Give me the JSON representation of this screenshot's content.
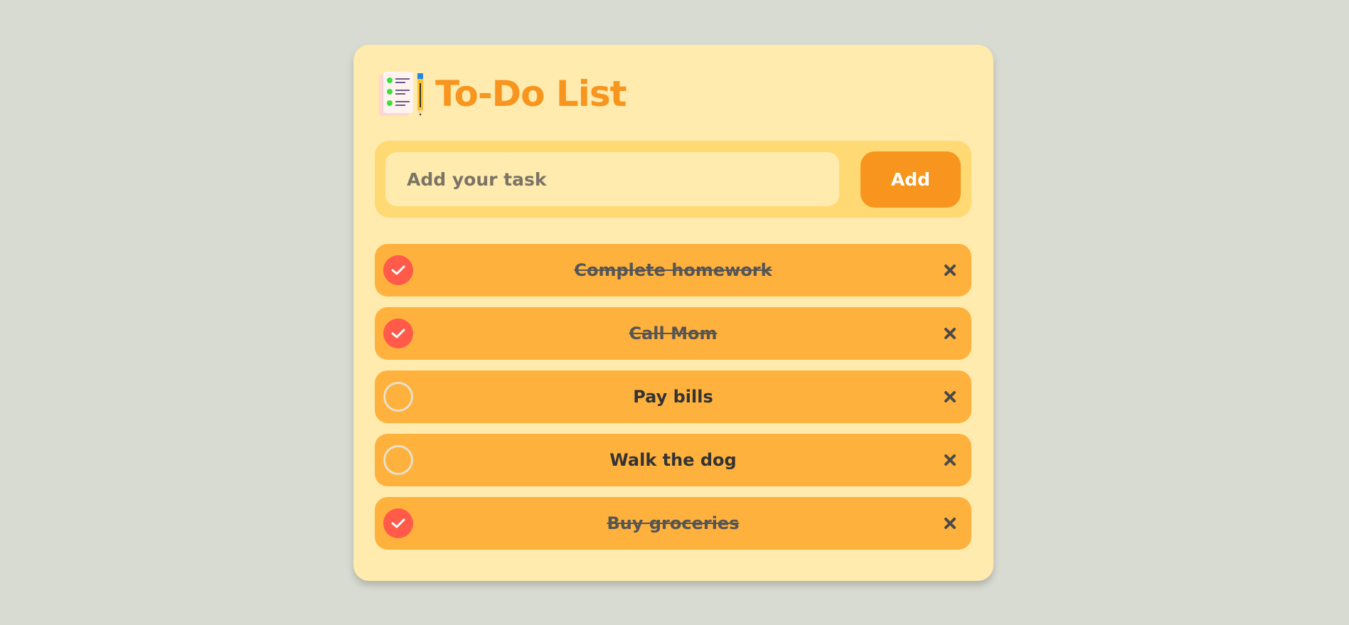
{
  "app": {
    "title": "To-Do List",
    "logo_icon": "checklist-pencil-icon"
  },
  "input": {
    "placeholder": "Add your task",
    "value": ""
  },
  "add_button": {
    "label": "Add"
  },
  "tasks": [
    {
      "text": "Complete homework",
      "completed": true
    },
    {
      "text": "Call Mom",
      "completed": true
    },
    {
      "text": "Pay bills",
      "completed": false
    },
    {
      "text": "Walk the dog",
      "completed": false
    },
    {
      "text": "Buy groceries",
      "completed": true
    }
  ],
  "colors": {
    "background": "#d8dbd1",
    "card": "#ffebad",
    "input_row": "#ffda74",
    "accent": "#f7951f",
    "task_item": "#ffb13d",
    "check_done": "#ff5a4a"
  },
  "icons": {
    "check": "checkmark-icon",
    "delete": "close-icon"
  }
}
